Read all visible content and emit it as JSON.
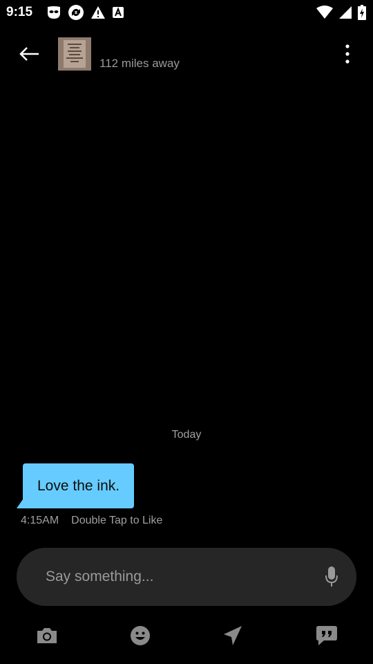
{
  "status_bar": {
    "time": "9:15",
    "left_icons": [
      "mask-app-icon",
      "sync-icon",
      "warning-icon",
      "font-app-icon"
    ],
    "right_icons": [
      "wifi-icon",
      "signal-icon",
      "battery-icon"
    ]
  },
  "header": {
    "distance": "112 miles away",
    "avatar_text": "YOUR BODY IS NOT A TEMPLE... IT'S AN AMUSEMENT PARK"
  },
  "conversation": {
    "date_divider": "Today",
    "messages": [
      {
        "text": "Love the ink.",
        "time": "4:15AM",
        "hint": "Double Tap to Like",
        "color": "#66ccff"
      }
    ]
  },
  "composer": {
    "placeholder": "Say something..."
  },
  "toolbar": {
    "items": [
      "camera-icon",
      "emoji-icon",
      "location-icon",
      "quick-phrases-icon"
    ]
  },
  "colors": {
    "background": "#000000",
    "bubble": "#66ccff",
    "input_bg": "#262626",
    "muted_text": "#a0a0a0"
  }
}
